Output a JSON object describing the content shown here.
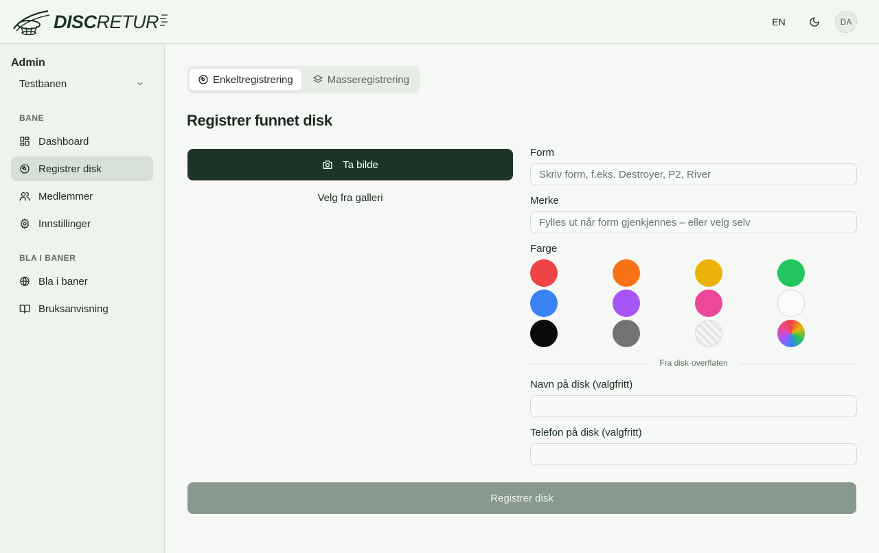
{
  "header": {
    "logo_bold": "DISC",
    "logo_light": "RETUR",
    "language": "EN",
    "avatar_initials": "DA"
  },
  "sidebar": {
    "title": "Admin",
    "course": "Testbanen",
    "section_course": "BANE",
    "section_browse": "BLA I BANER",
    "items": [
      {
        "label": "Dashboard",
        "icon": "dashboard-icon"
      },
      {
        "label": "Registrer disk",
        "icon": "disc-icon",
        "active": true
      },
      {
        "label": "Medlemmer",
        "icon": "users-icon"
      },
      {
        "label": "Innstillinger",
        "icon": "gear-icon"
      },
      {
        "label": "Bla i baner",
        "icon": "globe-icon"
      },
      {
        "label": "Bruksanvisning",
        "icon": "book-icon"
      }
    ]
  },
  "tabs": [
    {
      "label": "Enkeltregistrering",
      "icon": "disc-icon",
      "active": true
    },
    {
      "label": "Masseregistrering",
      "icon": "layers-icon",
      "active": false
    }
  ],
  "main": {
    "title": "Registrer funnet disk",
    "photo_button": "Ta bilde",
    "gallery_link": "Velg fra galleri",
    "submit_button": "Registrer disk"
  },
  "form": {
    "mold_label": "Form",
    "mold_placeholder": "Skriv form, f.eks. Destroyer, P2, River",
    "brand_label": "Merke",
    "brand_placeholder": "Fylles ut når form gjenkjennes – eller velg selv",
    "color_label": "Farge",
    "divider": "Fra disk-overflaten",
    "name_label": "Navn på disk (valgfritt)",
    "name_value": "",
    "phone_label": "Telefon på disk (valgfritt)",
    "phone_value": ""
  },
  "colors": [
    {
      "name": "red",
      "hex": "#ef4444"
    },
    {
      "name": "orange",
      "hex": "#f97316"
    },
    {
      "name": "yellow",
      "hex": "#eab308"
    },
    {
      "name": "green",
      "hex": "#22c55e"
    },
    {
      "name": "blue",
      "hex": "#3b82f6"
    },
    {
      "name": "purple",
      "hex": "#a855f7"
    },
    {
      "name": "pink",
      "hex": "#ec4899"
    },
    {
      "name": "white",
      "hex": "#fafafa"
    },
    {
      "name": "black",
      "hex": "#0a0a0a"
    },
    {
      "name": "gray",
      "hex": "#737373"
    },
    {
      "name": "transparent",
      "hex": "#e5e5e5"
    },
    {
      "name": "multicolor",
      "hex": "#ff0000"
    }
  ],
  "theme": {
    "accent": "#1c3528",
    "submit_disabled": "#889a90",
    "active_nav": "#d7e0d6"
  }
}
